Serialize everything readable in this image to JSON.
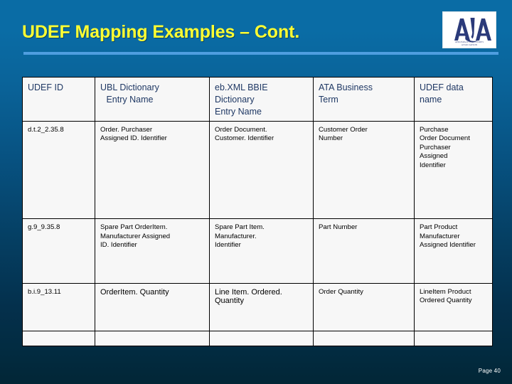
{
  "slide": {
    "title": "UDEF Mapping Examples – Cont.",
    "page_label": "Page 40",
    "accent_yellow": "#ffff33",
    "accent_rule": "#4f9ee0",
    "bg_top": "#0a6ca5",
    "bg_bottom": "#022636"
  },
  "logo": {
    "mark": "AIA",
    "line1": "AEROSPACE INDUSTRIES",
    "line2": "ASSOCIATION"
  },
  "table": {
    "headers": [
      "UDEF ID",
      "UBL Dictionary\nEntry Name",
      "eb.XML BBIE\nDictionary\nEntry Name",
      "ATA Business\nTerm",
      "UDEF data\nname"
    ],
    "rows": [
      {
        "udef_id": "d.t.2_2.35.8",
        "ubl": "Order.  Purchaser\nAssigned ID. Identifier",
        "ebxml": "Order Document.\nCustomer. Identifier",
        "ata": "Customer Order\nNumber",
        "udef_name": "Purchase\nOrder Document\nPurchaser\nAssigned\nIdentifier"
      },
      {
        "udef_id": "g.9_9.35.8",
        "ubl": "Spare Part OrderItem.\nManufacturer Assigned\nID. Identifier",
        "ebxml": "Spare Part Item.\nManufacturer.\nIdentifier",
        "ata": "Part Number",
        "udef_name": "Part Product\nManufacturer\nAssigned Identifier"
      },
      {
        "udef_id": "b.i.9_13.11",
        "ubl": "OrderItem. Quantity",
        "ebxml": "Line Item. Ordered.\nQuantity",
        "ata": "Order Quantity",
        "udef_name": "LineItem Product\nOrdered Quantity"
      },
      {
        "udef_id": "",
        "ubl": "",
        "ebxml": "",
        "ata": "",
        "udef_name": ""
      }
    ]
  }
}
